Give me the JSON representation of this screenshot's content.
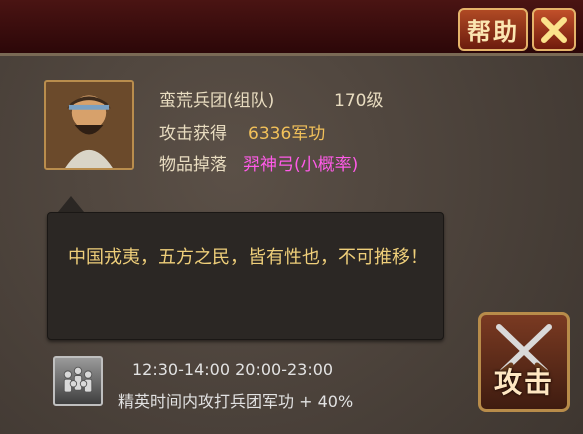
{
  "header": {
    "help_label": "帮助",
    "close_icon": "close-x-icon"
  },
  "boss": {
    "name": "蛮荒兵团(组队)",
    "level": "170级",
    "reward_label": "攻击获得",
    "reward_value": "6336军功",
    "drop_label": "物品掉落",
    "drop_item": "羿神弓",
    "drop_note": "(小概率)"
  },
  "quote": "中国戎夷，五方之民，皆有性也，不可推移！",
  "elite": {
    "times": "12:30-14:00  20:00-23:00",
    "bonus": "精英时间内攻打兵团军功 + 40%"
  },
  "attack_button": {
    "label": "攻击"
  },
  "colors": {
    "accent": "#f2c15a",
    "item": "#ff5be8"
  }
}
